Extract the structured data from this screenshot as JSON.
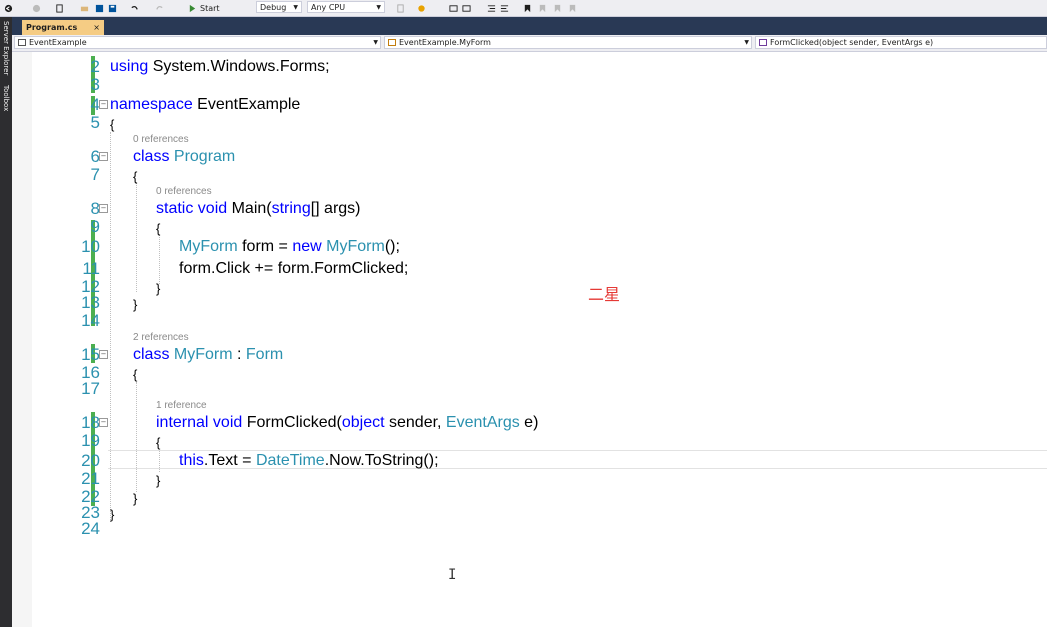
{
  "toolbar": {
    "start_label": "Start",
    "config": "Debug",
    "platform": "Any CPU"
  },
  "side_tabs": [
    "Server Explorer",
    "Toolbox"
  ],
  "tab": {
    "label": "Program.cs",
    "close": "×"
  },
  "nav": {
    "project": "EventExample",
    "class": "EventExample.MyForm",
    "member": "FormClicked(object sender, EventArgs e)"
  },
  "lines": [
    {
      "n": "2"
    },
    {
      "n": "3"
    },
    {
      "n": "4"
    },
    {
      "n": "5"
    },
    {
      "n": "6"
    },
    {
      "n": "7"
    },
    {
      "n": "8"
    },
    {
      "n": "9"
    },
    {
      "n": "10"
    },
    {
      "n": "11"
    },
    {
      "n": "12"
    },
    {
      "n": "13"
    },
    {
      "n": "14"
    },
    {
      "n": "15"
    },
    {
      "n": "16"
    },
    {
      "n": "17"
    },
    {
      "n": "18"
    },
    {
      "n": "19"
    },
    {
      "n": "20"
    },
    {
      "n": "21"
    },
    {
      "n": "22"
    },
    {
      "n": "23"
    },
    {
      "n": "24"
    }
  ],
  "code": {
    "l2_using": "using",
    "l2_ns": " System.Windows.Forms;",
    "l4_kw": "namespace",
    "l4_name": " EventExample",
    "open": "{",
    "close": "}",
    "l6_kw": "class",
    "l6_name": " Program",
    "l8_kw": "static void",
    "l8_name": " Main(",
    "l8_str": "string",
    "l8_rest": "[] args)",
    "l10_t1": "MyForm",
    "l10_mid": " form = ",
    "l10_new": "new",
    "l10_t2": " MyForm",
    "l10_end": "();",
    "l11": "form.Click += form.FormClicked;",
    "l15_kw": "class",
    "l15_name": " MyForm",
    "l15_colon": " : ",
    "l15_base": "Form",
    "l18_kw": "internal void",
    "l18_name": " FormClicked(",
    "l18_obj": "object",
    "l18_mid": " sender, ",
    "l18_ev": "EventArgs",
    "l18_end": " e)",
    "l20_this": "this",
    "l20_mid": ".Text = ",
    "l20_dt": "DateTime",
    "l20_end": ".Now.ToString();"
  },
  "refs": {
    "program": "0 references",
    "main": "0 references",
    "myform": "2 references",
    "formclicked": "1 reference"
  },
  "annotation": "二星",
  "colors": {
    "keyword": "#0000ff",
    "type": "#2b91af",
    "line_number": "#2b91af",
    "change_marker": "#4caf50",
    "annotation": "#e53935"
  }
}
